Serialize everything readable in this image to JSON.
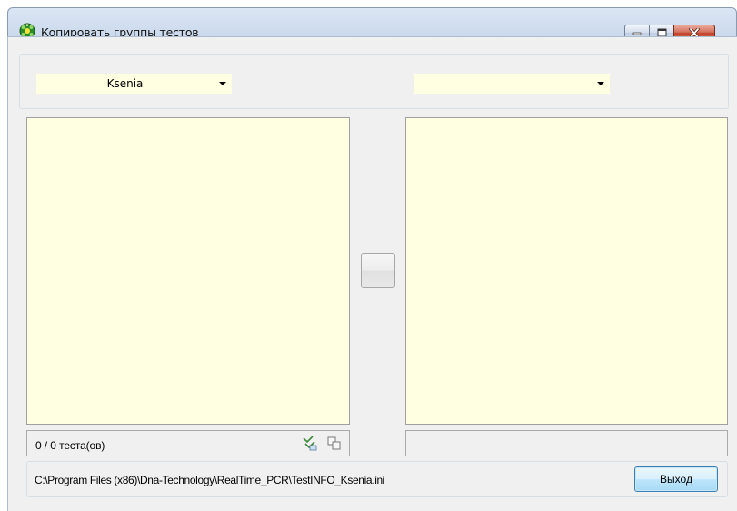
{
  "window": {
    "title": "Копировать группы тестов",
    "icon": "green-molecule-icon"
  },
  "title_buttons": {
    "minimize": "minimize-icon",
    "maximize": "maximize-icon",
    "close": "close-icon"
  },
  "source": {
    "selected": "Ksenia",
    "count_label": "0 / 0 теста(ов)",
    "tool_icons": [
      "select-all-icon",
      "copy-icon"
    ]
  },
  "target": {
    "selected": ""
  },
  "footer": {
    "path": "C:\\Program Files (x86)\\Dna-Technology\\RealTime_PCR\\TestINFO_Ksenia.ini",
    "exit_label": "Выход"
  },
  "colors": {
    "list_background": "#ffffe1",
    "form_background": "#f0f0f0",
    "titlebar": "#c9d8ec",
    "close_button": "#c0412a"
  }
}
